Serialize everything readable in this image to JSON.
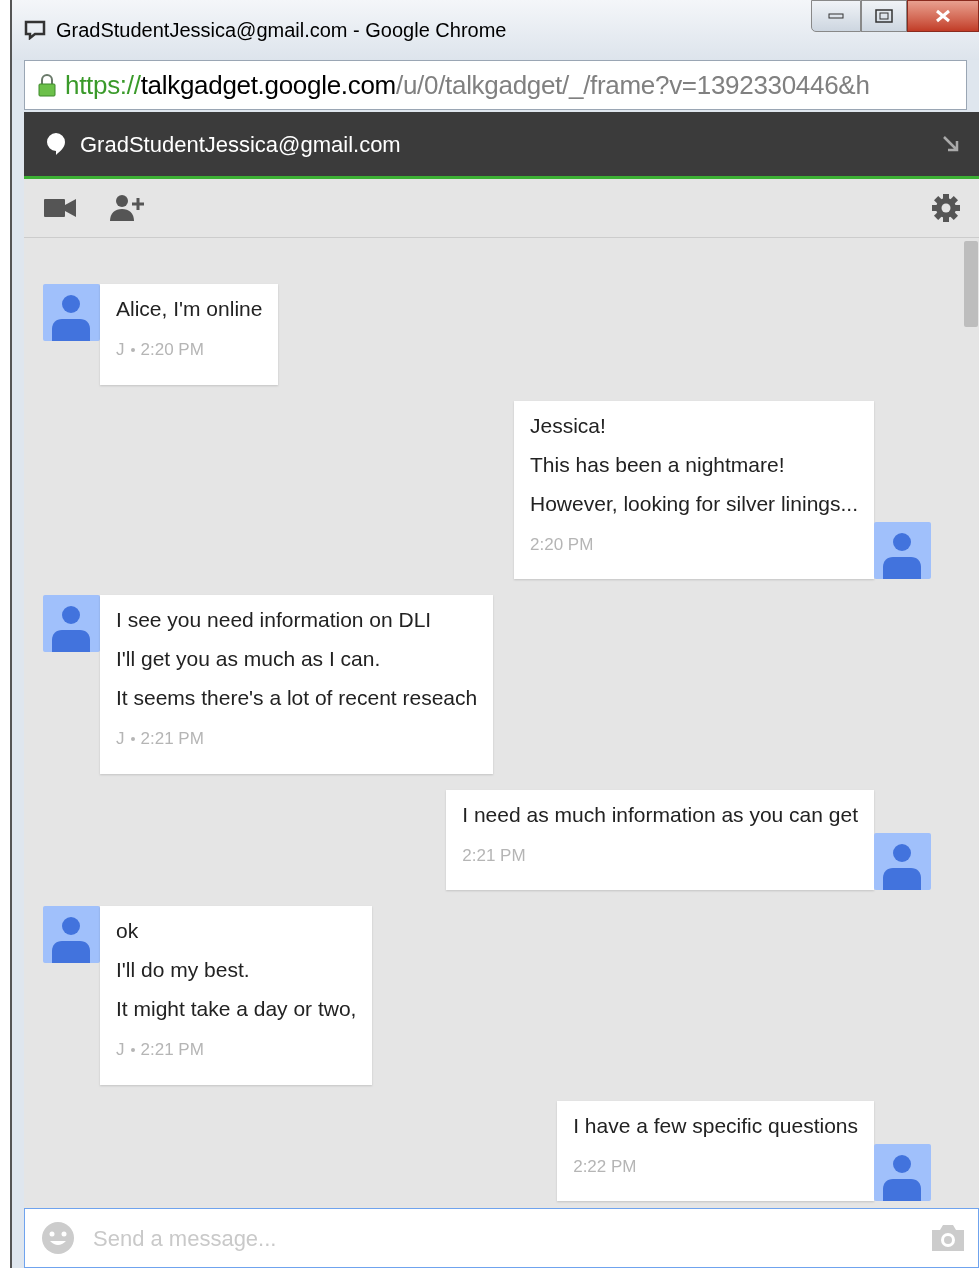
{
  "window": {
    "title": "GradStudentJessica@gmail.com - Google Chrome"
  },
  "address_bar": {
    "scheme": "https://",
    "host": "talkgadget.google.com",
    "path": "/u/0/talkgadget/_/frame?v=1392330446&h"
  },
  "chat_header": {
    "title": "GradStudentJessica@gmail.com"
  },
  "messages": [
    {
      "kind": "incoming",
      "lines": [
        "Alice, I'm online"
      ],
      "sender": "J",
      "time": "2:20 PM"
    },
    {
      "kind": "outgoing",
      "lines": [
        "Jessica!",
        "This has been a nightmare!",
        "However, looking for silver linings..."
      ],
      "time": "2:20 PM"
    },
    {
      "kind": "incoming",
      "lines": [
        "I see you need information on DLI",
        "I'll get you as much as I can.",
        "It seems there's a lot of recent reseach"
      ],
      "sender": "J",
      "time": "2:21 PM"
    },
    {
      "kind": "outgoing",
      "lines": [
        "I need as much information as you can get"
      ],
      "time": "2:21 PM"
    },
    {
      "kind": "incoming",
      "lines": [
        "ok",
        "I'll do my best.",
        "It might take a day or two,"
      ],
      "sender": "J",
      "time": "2:21 PM"
    },
    {
      "kind": "outgoing",
      "lines": [
        "I have a few specific questions"
      ],
      "time": "2:22 PM"
    }
  ],
  "composer": {
    "placeholder": "Send a message..."
  }
}
